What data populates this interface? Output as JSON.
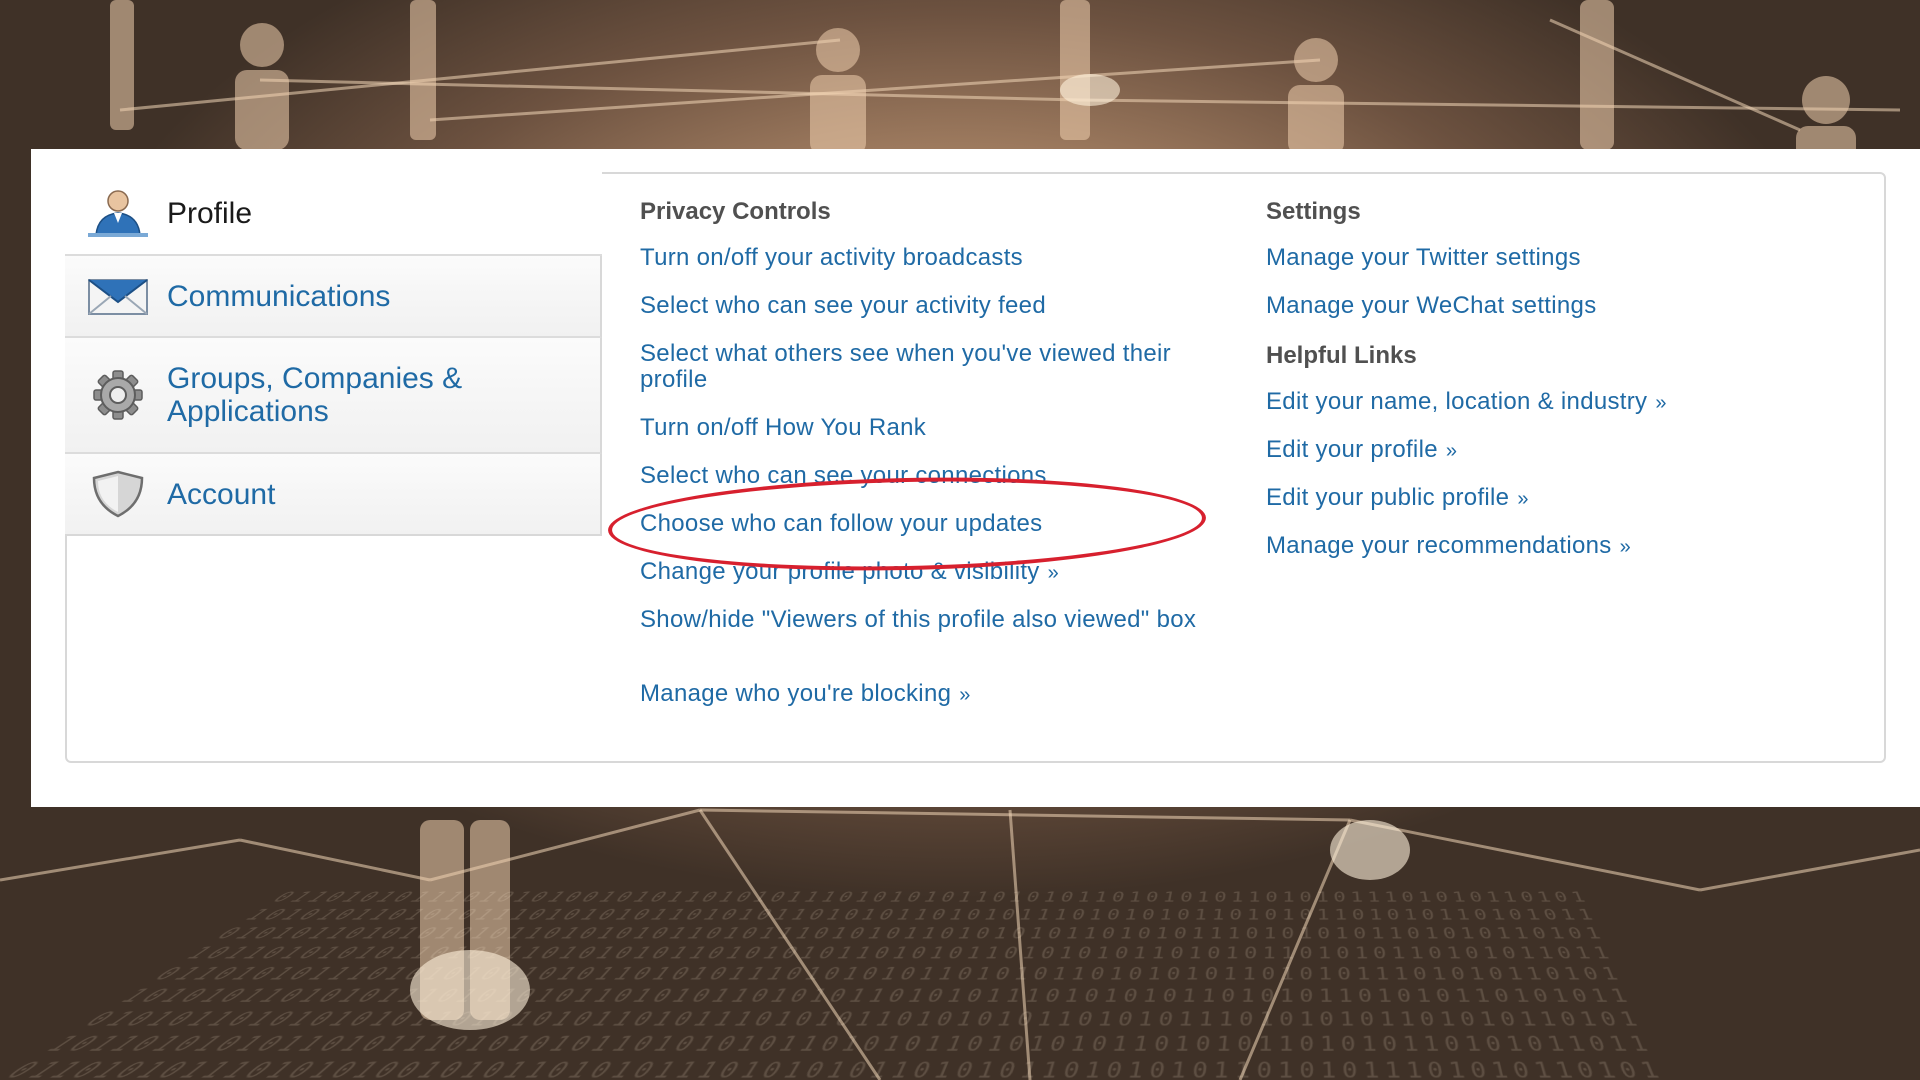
{
  "nav": {
    "items": [
      {
        "label": "Profile",
        "icon": "user-profile-icon",
        "active": true
      },
      {
        "label": "Communications",
        "icon": "envelope-icon",
        "active": false
      },
      {
        "label": "Groups, Companies & Applications",
        "icon": "gear-icon",
        "active": false
      },
      {
        "label": "Account",
        "icon": "shield-icon",
        "active": false
      }
    ]
  },
  "privacy": {
    "heading": "Privacy Controls",
    "links": [
      "Turn on/off your activity broadcasts",
      "Select who can see your activity feed",
      "Select what others see when you've viewed their profile",
      "Turn on/off How You Rank",
      "Select who can see your connections",
      "Choose who can follow your updates",
      "Change your profile photo & visibility",
      "Show/hide \"Viewers of this profile also viewed\" box",
      "Manage who you're blocking"
    ],
    "raquo": "»"
  },
  "settings": {
    "heading": "Settings",
    "links": [
      "Manage your Twitter settings",
      "Manage your WeChat settings"
    ]
  },
  "helpful": {
    "heading": "Helpful Links",
    "links": [
      "Edit your name, location & industry",
      "Edit your profile",
      "Edit your public profile",
      "Manage your recommendations"
    ],
    "raquo": "»"
  },
  "colors": {
    "link": "#1f6aa5",
    "annotation": "#d7202e"
  }
}
